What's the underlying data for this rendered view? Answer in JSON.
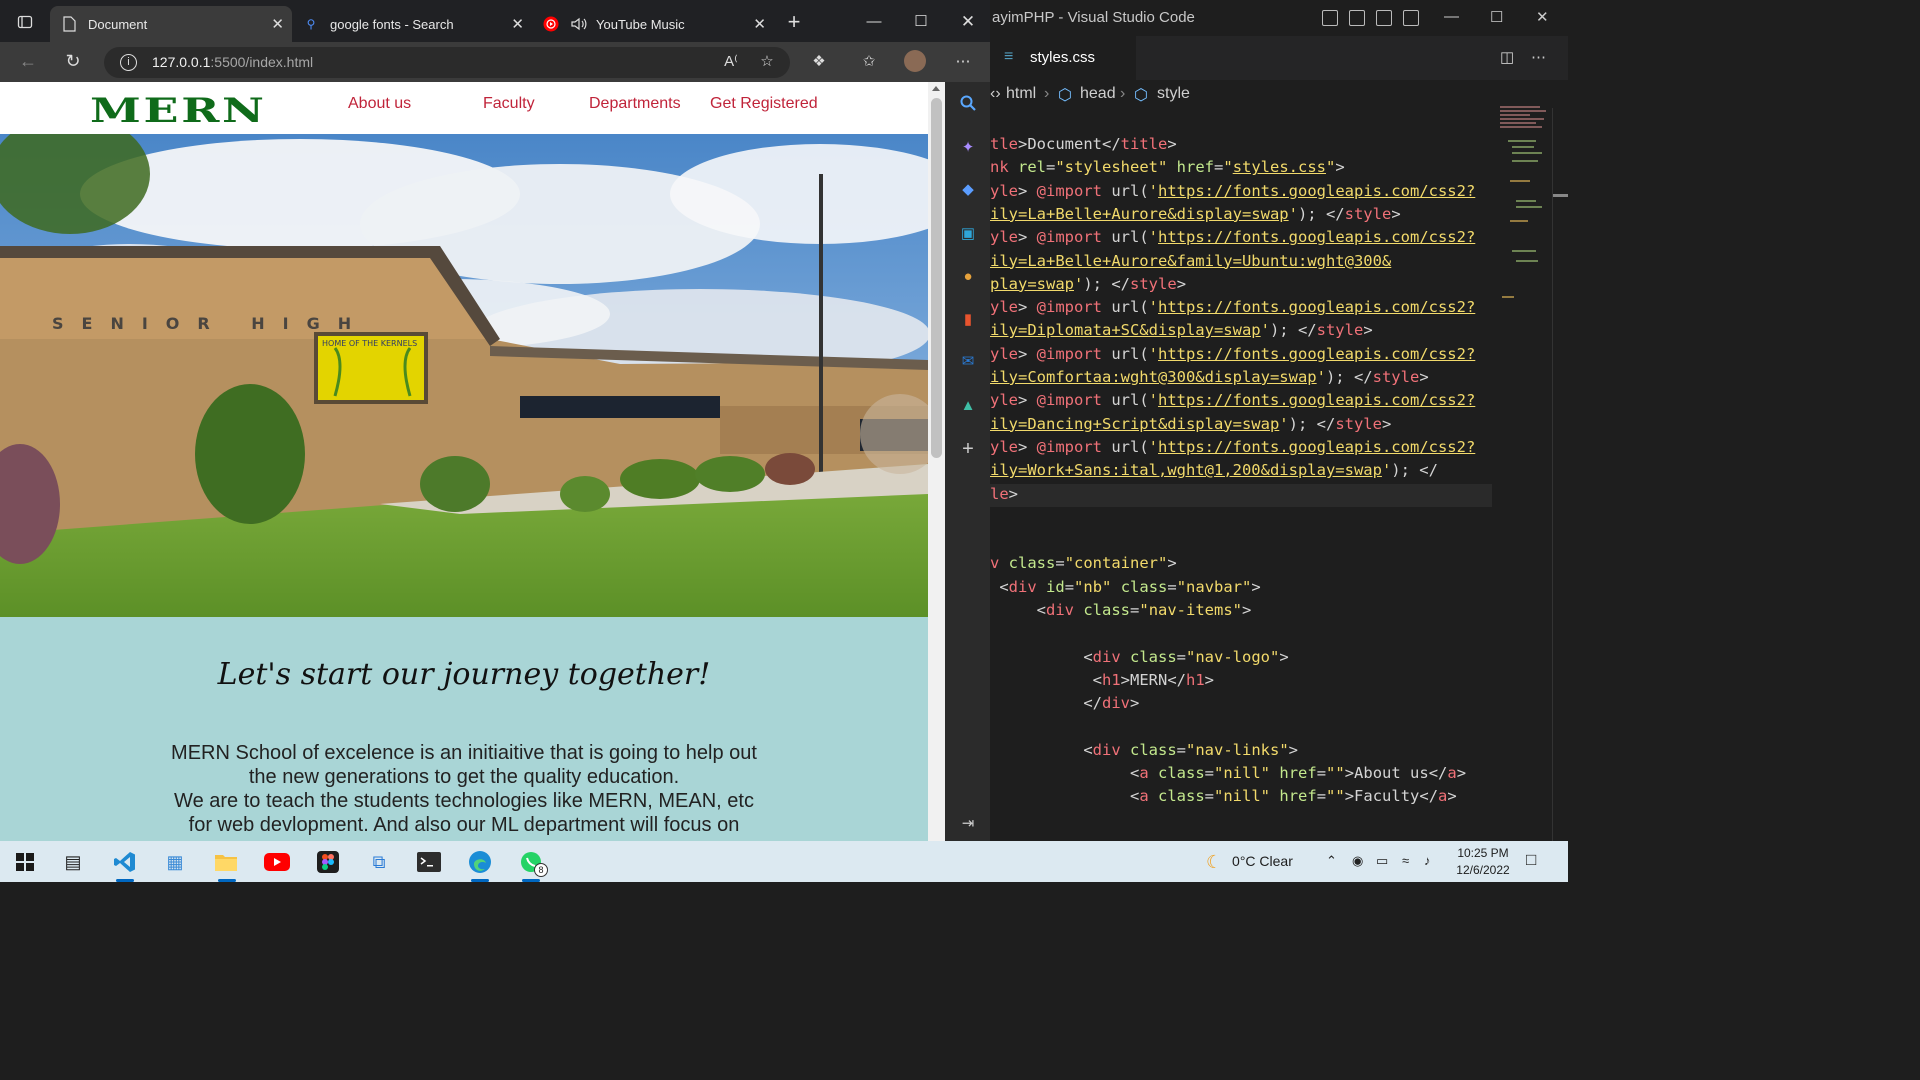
{
  "browser": {
    "tabs": [
      {
        "title": "Document",
        "icon": "page-icon",
        "active": true
      },
      {
        "title": "google fonts - Search",
        "icon": "search-icon",
        "active": false
      },
      {
        "title": "YouTube Music",
        "icon": "youtube-music-icon",
        "active": false,
        "audio": true
      }
    ],
    "new_tab": "+",
    "address": {
      "host": "127.0.0.1",
      "path": ":5500/index.html"
    }
  },
  "site": {
    "logo": "MERN",
    "nav_links": [
      "About us",
      "Faculty",
      "Departments",
      "Get Registered"
    ],
    "hero_sign": "SENIOR HIGH",
    "hero_board": "HOME OF THE KERNELS",
    "heading": "Let's start our journey together!",
    "paragraph": [
      "MERN School of excelence is an initiaitive that is going to help out",
      "the new generations to get the quality education.",
      "We are to teach the students technologies like MERN, MEAN, etc",
      "for web devlopment. And also our ML department will focus on"
    ]
  },
  "vscode": {
    "title": "ayimPHP - Visual Studio Code",
    "tab": "styles.css",
    "breadcrumbs": [
      "html",
      "head",
      "style"
    ],
    "code_lines": [
      {
        "segs": [
          [
            "t",
            "tle"
          ],
          [
            "p",
            ">Document</"
          ],
          [
            "t",
            "title"
          ],
          [
            "p",
            ">"
          ]
        ]
      },
      {
        "segs": [
          [
            "t",
            "nk "
          ],
          [
            "a",
            "rel"
          ],
          [
            "p",
            "="
          ],
          [
            "s",
            "\"stylesheet\""
          ],
          [
            "p",
            " "
          ],
          [
            "a",
            "href"
          ],
          [
            "p",
            "="
          ],
          [
            "s",
            "\""
          ],
          [
            "u",
            "styles.css"
          ],
          [
            "s",
            "\""
          ],
          [
            "p",
            ">"
          ]
        ]
      },
      {
        "segs": [
          [
            "t",
            "yle"
          ],
          [
            "p",
            "> "
          ],
          [
            "kw",
            "@import"
          ],
          [
            "p",
            " url("
          ],
          [
            "s",
            "'"
          ],
          [
            "u",
            "https://fonts.googleapis.com/css2?"
          ]
        ]
      },
      {
        "segs": [
          [
            "u",
            "ily=La+Belle+Aurore&display=swap"
          ],
          [
            "s",
            "'"
          ],
          [
            "p",
            "); </"
          ],
          [
            "t",
            "style"
          ],
          [
            "p",
            ">"
          ]
        ]
      },
      {
        "segs": [
          [
            "t",
            "yle"
          ],
          [
            "p",
            "> "
          ],
          [
            "kw",
            "@import"
          ],
          [
            "p",
            " url("
          ],
          [
            "s",
            "'"
          ],
          [
            "u",
            "https://fonts.googleapis.com/css2?"
          ]
        ]
      },
      {
        "segs": [
          [
            "u",
            "ily=La+Belle+Aurore&family=Ubuntu:wght@300&"
          ]
        ]
      },
      {
        "segs": [
          [
            "u",
            "play=swap"
          ],
          [
            "s",
            "'"
          ],
          [
            "p",
            "); </"
          ],
          [
            "t",
            "style"
          ],
          [
            "p",
            ">"
          ]
        ]
      },
      {
        "segs": [
          [
            "t",
            "yle"
          ],
          [
            "p",
            "> "
          ],
          [
            "kw",
            "@import"
          ],
          [
            "p",
            " url("
          ],
          [
            "s",
            "'"
          ],
          [
            "u",
            "https://fonts.googleapis.com/css2?"
          ]
        ]
      },
      {
        "segs": [
          [
            "u",
            "ily=Diplomata+SC&display=swap"
          ],
          [
            "s",
            "'"
          ],
          [
            "p",
            "); </"
          ],
          [
            "t",
            "style"
          ],
          [
            "p",
            ">"
          ]
        ]
      },
      {
        "segs": [
          [
            "t",
            "yle"
          ],
          [
            "p",
            "> "
          ],
          [
            "kw",
            "@import"
          ],
          [
            "p",
            " url("
          ],
          [
            "s",
            "'"
          ],
          [
            "u",
            "https://fonts.googleapis.com/css2?"
          ]
        ]
      },
      {
        "segs": [
          [
            "u",
            "ily=Comfortaa:wght@300&display=swap"
          ],
          [
            "s",
            "'"
          ],
          [
            "p",
            "); </"
          ],
          [
            "t",
            "style"
          ],
          [
            "p",
            ">"
          ]
        ]
      },
      {
        "segs": [
          [
            "t",
            "yle"
          ],
          [
            "p",
            "> "
          ],
          [
            "kw",
            "@import"
          ],
          [
            "p",
            " url("
          ],
          [
            "s",
            "'"
          ],
          [
            "u",
            "https://fonts.googleapis.com/css2?"
          ]
        ]
      },
      {
        "segs": [
          [
            "u",
            "ily=Dancing+Script&display=swap"
          ],
          [
            "s",
            "'"
          ],
          [
            "p",
            "); </"
          ],
          [
            "t",
            "style"
          ],
          [
            "p",
            ">"
          ]
        ]
      },
      {
        "segs": [
          [
            "t",
            "yle"
          ],
          [
            "p",
            "> "
          ],
          [
            "kw",
            "@import"
          ],
          [
            "p",
            " url("
          ],
          [
            "s",
            "'"
          ],
          [
            "u",
            "https://fonts.googleapis.com/css2?"
          ]
        ]
      },
      {
        "segs": [
          [
            "u",
            "ily=Work+Sans:ital,wght@1,200&display=swap"
          ],
          [
            "s",
            "'"
          ],
          [
            "p",
            "); </"
          ]
        ]
      },
      {
        "segs": [
          [
            "t",
            "le"
          ],
          [
            "p",
            ">"
          ]
        ]
      },
      {
        "segs": []
      },
      {
        "segs": []
      },
      {
        "segs": [
          [
            "t",
            "v "
          ],
          [
            "a",
            "class"
          ],
          [
            "p",
            "="
          ],
          [
            "s",
            "\"container\""
          ],
          [
            "p",
            ">"
          ]
        ]
      },
      {
        "segs": [
          [
            "p",
            " <"
          ],
          [
            "t",
            "div"
          ],
          [
            "p",
            " "
          ],
          [
            "a",
            "id"
          ],
          [
            "p",
            "="
          ],
          [
            "s",
            "\"nb\""
          ],
          [
            "p",
            " "
          ],
          [
            "a",
            "class"
          ],
          [
            "p",
            "="
          ],
          [
            "s",
            "\"navbar\""
          ],
          [
            "p",
            ">"
          ]
        ]
      },
      {
        "segs": [
          [
            "p",
            "     <"
          ],
          [
            "t",
            "div"
          ],
          [
            "p",
            " "
          ],
          [
            "a",
            "class"
          ],
          [
            "p",
            "="
          ],
          [
            "s",
            "\"nav-items\""
          ],
          [
            "p",
            ">"
          ]
        ]
      },
      {
        "segs": []
      },
      {
        "segs": [
          [
            "p",
            "          <"
          ],
          [
            "t",
            "div"
          ],
          [
            "p",
            " "
          ],
          [
            "a",
            "class"
          ],
          [
            "p",
            "="
          ],
          [
            "s",
            "\"nav-logo\""
          ],
          [
            "p",
            ">"
          ]
        ]
      },
      {
        "segs": [
          [
            "p",
            "           <"
          ],
          [
            "t",
            "h1"
          ],
          [
            "p",
            ">MERN</"
          ],
          [
            "t",
            "h1"
          ],
          [
            "p",
            ">"
          ]
        ]
      },
      {
        "segs": [
          [
            "p",
            "          </"
          ],
          [
            "t",
            "div"
          ],
          [
            "p",
            ">"
          ]
        ]
      },
      {
        "segs": []
      },
      {
        "segs": [
          [
            "p",
            "          <"
          ],
          [
            "t",
            "div"
          ],
          [
            "p",
            " "
          ],
          [
            "a",
            "class"
          ],
          [
            "p",
            "="
          ],
          [
            "s",
            "\"nav-links\""
          ],
          [
            "p",
            ">"
          ]
        ]
      },
      {
        "segs": [
          [
            "p",
            "               <"
          ],
          [
            "t",
            "a"
          ],
          [
            "p",
            " "
          ],
          [
            "a",
            "class"
          ],
          [
            "p",
            "="
          ],
          [
            "s",
            "\"nill\""
          ],
          [
            "p",
            " "
          ],
          [
            "a",
            "href"
          ],
          [
            "p",
            "="
          ],
          [
            "s",
            "\"\""
          ],
          [
            "p",
            ">About us</"
          ],
          [
            "t",
            "a"
          ],
          [
            "p",
            ">"
          ]
        ]
      },
      {
        "segs": [
          [
            "p",
            "               <"
          ],
          [
            "t",
            "a"
          ],
          [
            "p",
            " "
          ],
          [
            "a",
            "class"
          ],
          [
            "p",
            "="
          ],
          [
            "s",
            "\"nill\""
          ],
          [
            "p",
            " "
          ],
          [
            "a",
            "href"
          ],
          [
            "p",
            "="
          ],
          [
            "s",
            "\"\""
          ],
          [
            "p",
            ">Faculty</"
          ],
          [
            "t",
            "a"
          ],
          [
            "p",
            ">"
          ]
        ]
      }
    ]
  },
  "taskbar": {
    "apps": [
      "windows-start",
      "task-view",
      "vscode",
      "control-panel",
      "file-explorer",
      "youtube",
      "figma",
      "remote-desktop",
      "terminal",
      "edge",
      "whatsapp"
    ],
    "whatsapp_badge": "8",
    "weather": "0°C  Clear",
    "time": "10:25 PM",
    "date": "12/6/2022"
  },
  "colors": {
    "logo": "#0f6b1a",
    "nav_link": "#c0243a",
    "about_bg": "#a9d5d6",
    "accent": "#0067c0"
  }
}
